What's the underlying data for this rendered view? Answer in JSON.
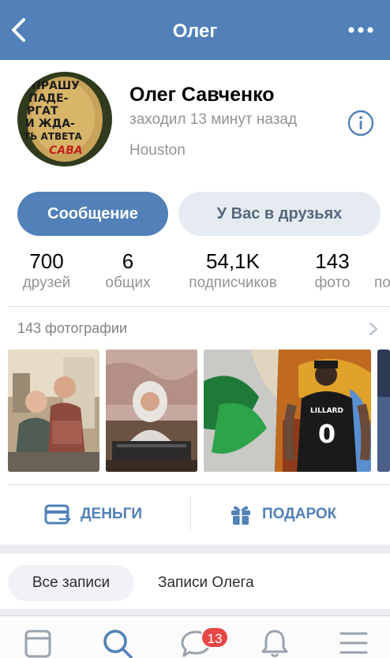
{
  "header": {
    "title": "Олег",
    "back_icon": "chevron-left-icon",
    "more_icon": "more-horizontal-icon",
    "background": "#5181b8"
  },
  "profile": {
    "name": "Олег Савченко",
    "last_seen": "заходил 13 минут назад",
    "city": "Houston",
    "avatar_text": [
      "ПРАШУ",
      "ПАДЕ-",
      "РГАТ",
      "И ЖДА-",
      "ТЬ АТВЕТА",
      "САВА"
    ]
  },
  "buttons": {
    "message": "Сообщение",
    "friends": "У Вас в друзьях"
  },
  "counters": [
    {
      "num": "700",
      "label": "друзей"
    },
    {
      "num": "6",
      "label": "общих"
    },
    {
      "num": "54,1K",
      "label": "подписчиков"
    },
    {
      "num": "143",
      "label": "фото"
    },
    {
      "num": "",
      "label": "по"
    }
  ],
  "photos": {
    "label": "143 фотографии",
    "jersey_name": "LILLARD",
    "jersey_number": "0"
  },
  "actions": {
    "money": "ДЕНЬГИ",
    "gift": "ПОДАРОК"
  },
  "wall_tabs": {
    "all": "Все записи",
    "own": "Записи Олега"
  },
  "tabbar": {
    "messages_badge": "13",
    "icons": [
      "news-icon",
      "search-icon",
      "messages-icon",
      "notifications-icon",
      "menu-icon"
    ]
  },
  "colors": {
    "accent": "#5181b8",
    "badge": "#e64646",
    "secondary_text": "#939393"
  }
}
